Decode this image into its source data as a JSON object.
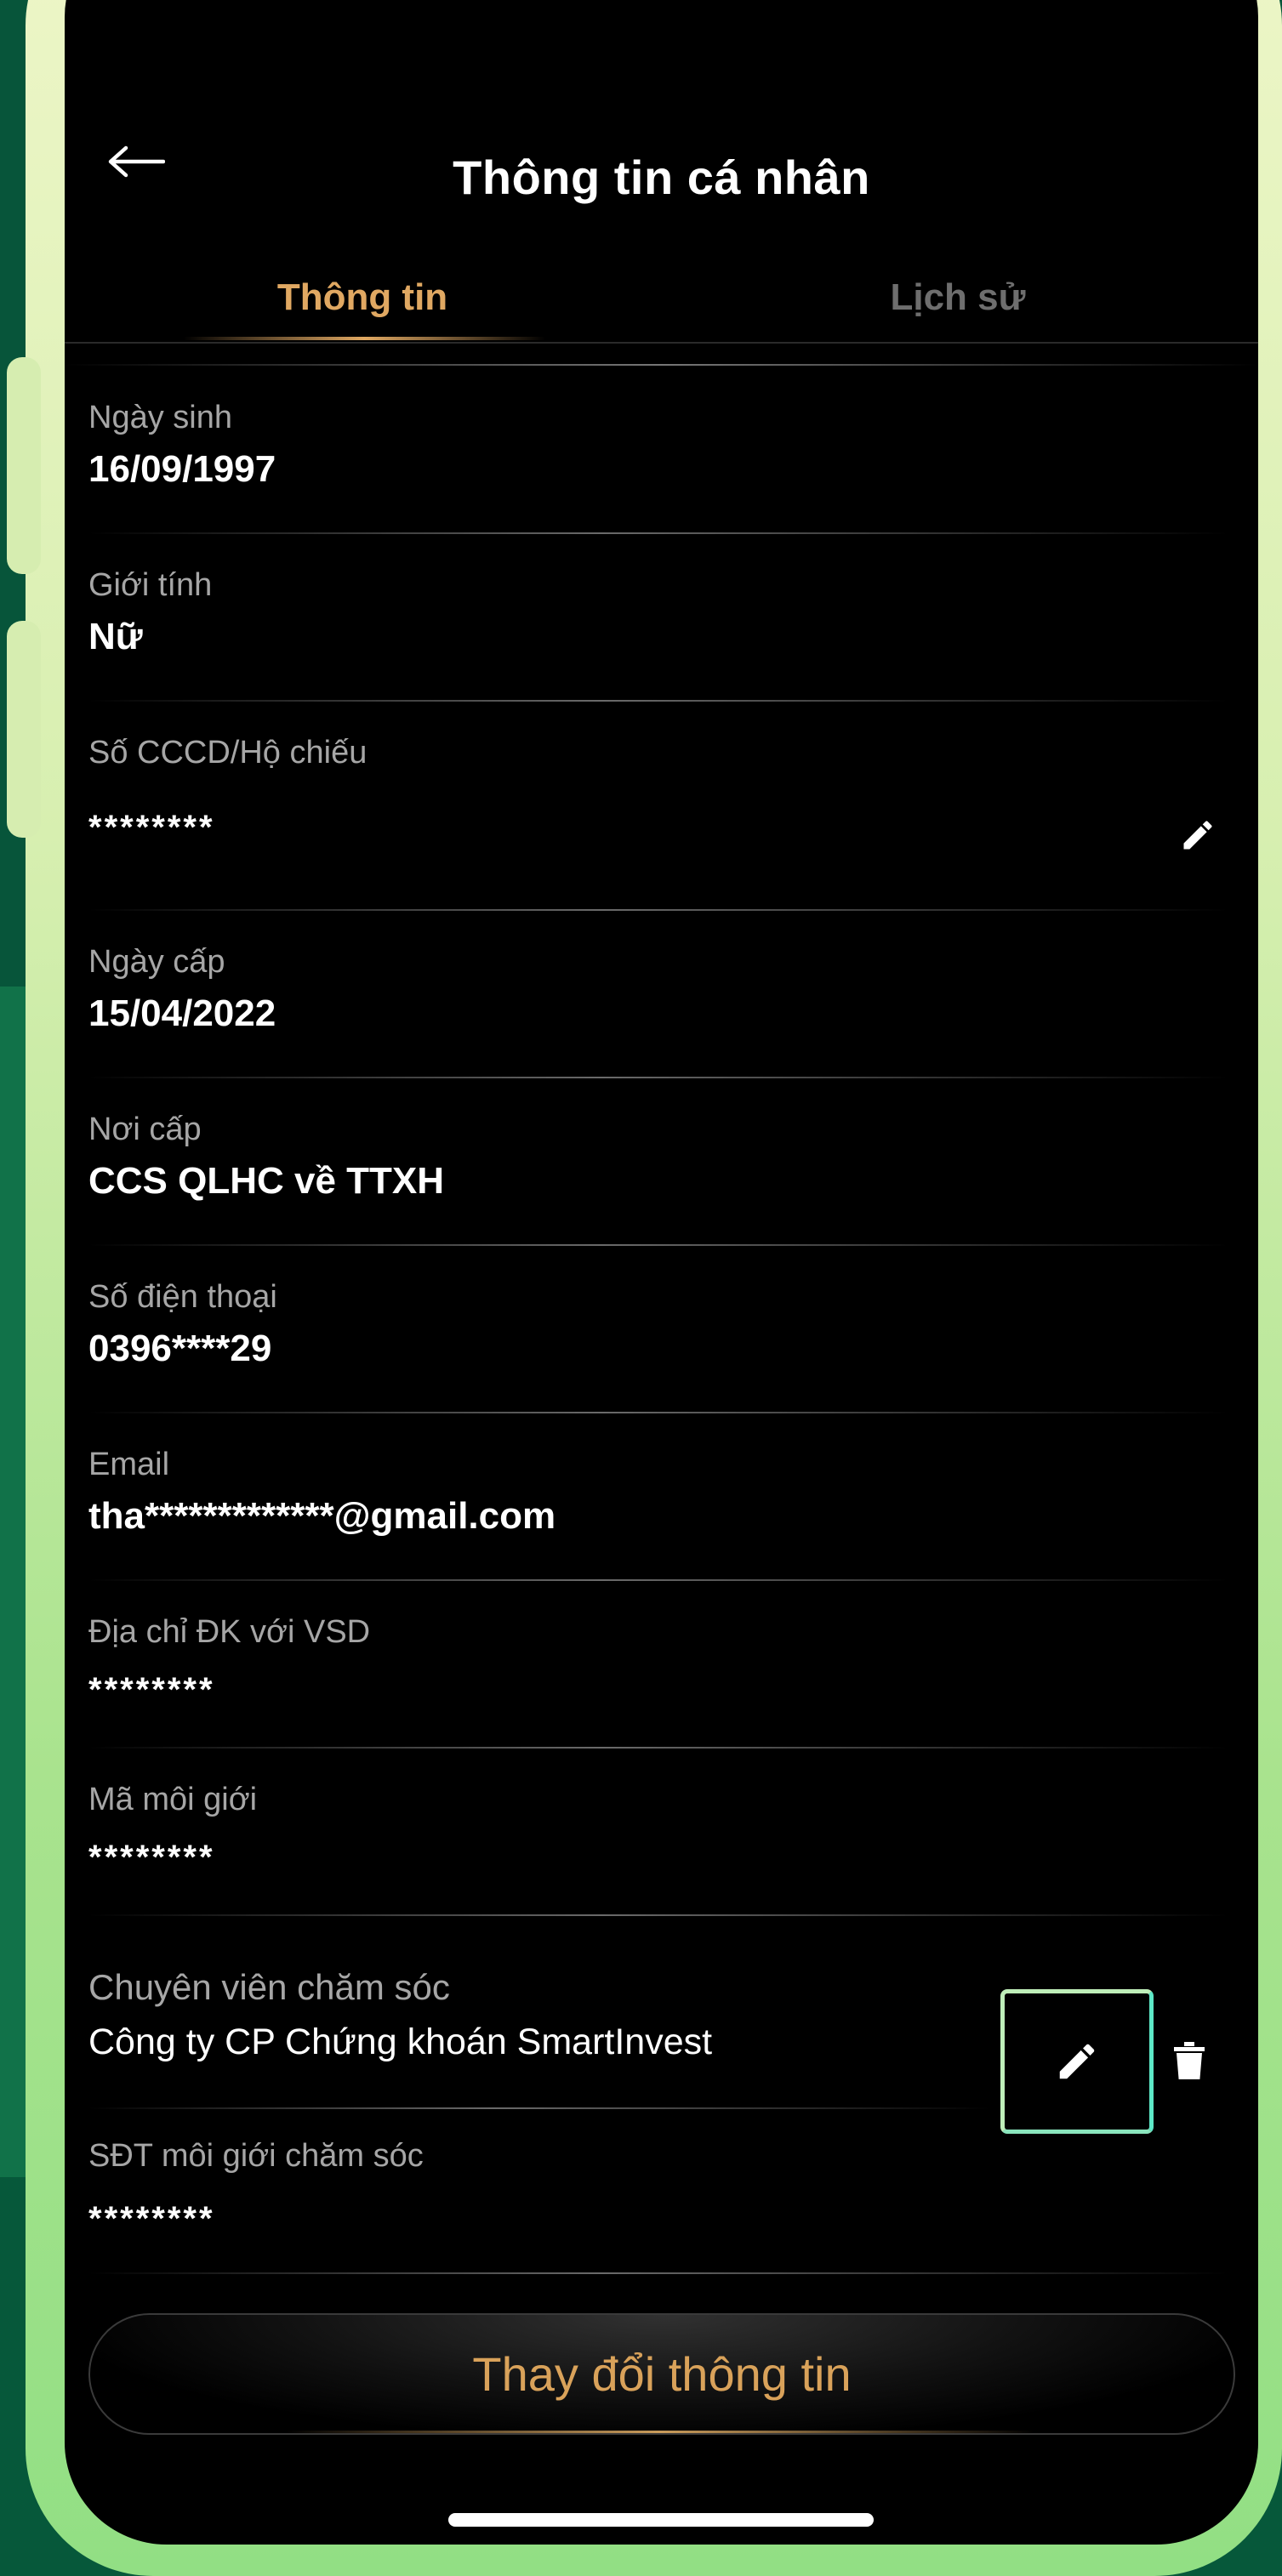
{
  "header": {
    "title": "Thông tin cá nhân"
  },
  "tabs": [
    {
      "label": "Thông tin",
      "active": true
    },
    {
      "label": "Lịch sử",
      "active": false
    }
  ],
  "fields": {
    "birth_date": {
      "label": "Ngày sinh",
      "value": "16/09/1997"
    },
    "gender": {
      "label": "Giới tính",
      "value": "Nữ"
    },
    "id_number": {
      "label": "Số CCCD/Hộ chiếu",
      "value": "********"
    },
    "issue_date": {
      "label": "Ngày cấp",
      "value": "15/04/2022"
    },
    "issue_place": {
      "label": "Nơi cấp",
      "value": "CCS QLHC về TTXH"
    },
    "phone": {
      "label": "Số điện thoại",
      "value": "0396****29"
    },
    "email": {
      "label": "Email",
      "value": "tha*************@gmail.com"
    },
    "vsd_address": {
      "label": "Địa chỉ ĐK với VSD",
      "value": "********"
    },
    "broker_code": {
      "label": "Mã môi giới",
      "value": "********"
    },
    "care_specialist": {
      "label": "Chuyên viên chăm sóc",
      "value": "Công ty CP Chứng khoán SmartInvest"
    },
    "care_broker_phone": {
      "label": "SĐT môi giới chăm sóc",
      "value": "********"
    }
  },
  "actions": {
    "change_info_label": "Thay đổi thông tin"
  },
  "colors": {
    "accent": "#e0a862",
    "background": "#000000",
    "frame": "#a9e38e",
    "highlight": "#5de8c7"
  },
  "icons": {
    "back": "arrow-left-icon",
    "edit": "pencil-icon",
    "delete": "trash-icon"
  }
}
